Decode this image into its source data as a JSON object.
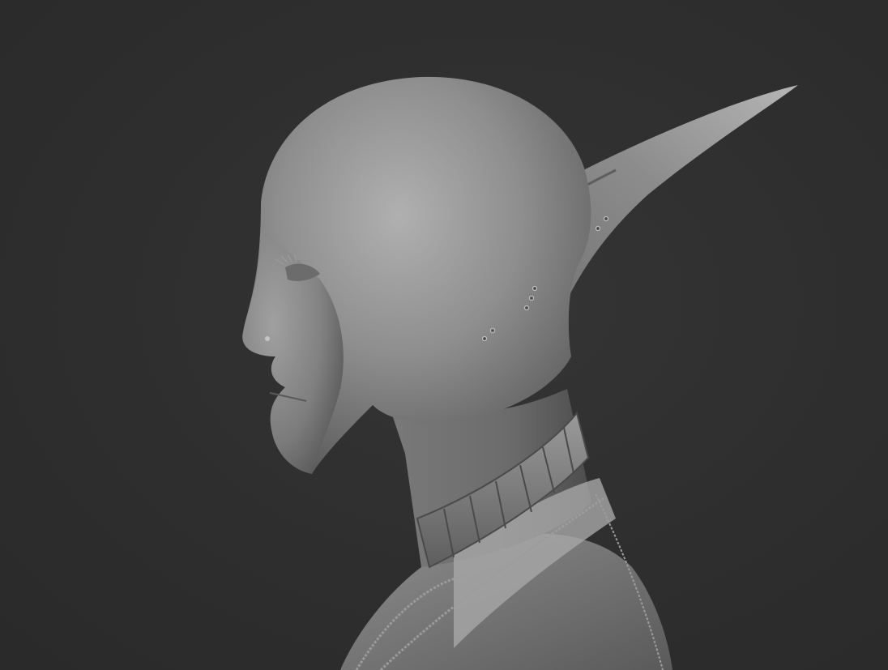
{
  "scene": {
    "background_color": "#2f2f2f",
    "subject": "grayscale-3d-sculpt",
    "material_color": "#8f8f8f"
  }
}
